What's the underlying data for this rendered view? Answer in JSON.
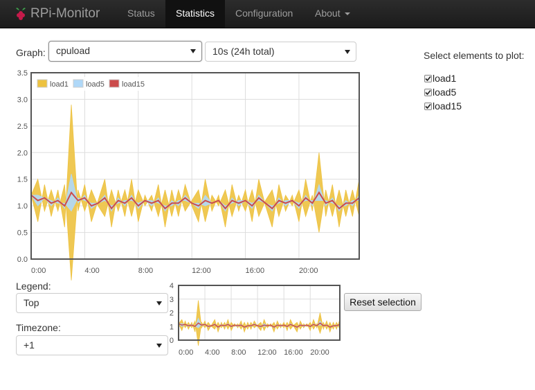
{
  "navbar": {
    "brand": "RPi-Monitor",
    "items": [
      {
        "label": "Status",
        "active": false
      },
      {
        "label": "Statistics",
        "active": true
      },
      {
        "label": "Configuration",
        "active": false
      },
      {
        "label": "About",
        "active": false
      }
    ]
  },
  "graph_select": {
    "label": "Graph:",
    "value": "cpuload"
  },
  "period_select": {
    "value": "10s (24h total)"
  },
  "legend_select": {
    "label": "Legend:",
    "value": "Top"
  },
  "timezone_select": {
    "label": "Timezone:",
    "value": "+1"
  },
  "reset_button": {
    "label": "Reset selection"
  },
  "plot_elements": {
    "title": "Select elements to plot:",
    "items": [
      {
        "label": "load1",
        "checked": true
      },
      {
        "label": "load5",
        "checked": true
      },
      {
        "label": "load15",
        "checked": true
      }
    ]
  },
  "chart_data": [
    {
      "type": "area",
      "x_unit": "hours",
      "xlim": [
        0,
        24.5
      ],
      "ylim": [
        0,
        3.5
      ],
      "y_ticks": [
        0.0,
        0.5,
        1.0,
        1.5,
        2.0,
        2.5,
        3.0,
        3.5
      ],
      "y_tick_labels": [
        "0.0",
        "0.5",
        "1.0",
        "1.5",
        "2.0",
        "2.5",
        "3.0",
        "3.5"
      ],
      "x_ticks": [
        0,
        4,
        8,
        12,
        16,
        20
      ],
      "x_tick_labels": [
        "0:00",
        "4:00",
        "8:00",
        "12:00",
        "16:00",
        "20:00"
      ],
      "grid": true,
      "legend_position": "top-left",
      "x": [
        0,
        0.5,
        1,
        1.5,
        2,
        2.5,
        3,
        3.5,
        4,
        4.5,
        5,
        5.5,
        6,
        6.5,
        7,
        7.5,
        8,
        8.5,
        9,
        9.5,
        10,
        10.5,
        11,
        11.5,
        12,
        12.5,
        13,
        13.5,
        14,
        14.5,
        15,
        15.5,
        16,
        16.5,
        17,
        17.5,
        18,
        18.5,
        19,
        19.5,
        20,
        20.5,
        21,
        21.5,
        22,
        22.5,
        23,
        23.5,
        24,
        24.5
      ],
      "series": [
        {
          "name": "load1",
          "color": "#edc240",
          "values": [
            1.2,
            0.7,
            1.4,
            0.8,
            1.3,
            0.6,
            2.9,
            0.9,
            1.4,
            0.7,
            1.1,
            1.5,
            0.6,
            1.3,
            0.8,
            1.5,
            0.7,
            1.2,
            0.9,
            1.4,
            0.6,
            1.3,
            0.8,
            1.4,
            1.0,
            0.7,
            1.5,
            0.9,
            1.2,
            0.6,
            1.4,
            0.9,
            1.3,
            0.7,
            1.5,
            1.0,
            0.6,
            1.4,
            0.9,
            1.2,
            0.7,
            1.5,
            0.9,
            2.0,
            0.8,
            1.4,
            0.6,
            1.3,
            0.8,
            1.5
          ]
        },
        {
          "name": "load5",
          "color": "#afd8f8",
          "values": [
            1.2,
            1.0,
            1.15,
            1.0,
            1.15,
            0.95,
            1.6,
            1.05,
            1.2,
            0.95,
            1.05,
            1.2,
            0.9,
            1.15,
            1.0,
            1.2,
            0.95,
            1.1,
            1.0,
            1.15,
            0.9,
            1.1,
            1.0,
            1.2,
            1.05,
            0.95,
            1.2,
            1.05,
            1.1,
            0.9,
            1.15,
            1.0,
            1.1,
            0.95,
            1.2,
            1.05,
            0.9,
            1.15,
            1.0,
            1.1,
            0.95,
            1.2,
            1.0,
            1.4,
            1.0,
            1.15,
            0.9,
            1.1,
            1.0,
            1.2
          ]
        },
        {
          "name": "load15",
          "color": "#cb4b4b",
          "values": [
            1.2,
            1.1,
            1.15,
            1.05,
            1.1,
            1.0,
            1.25,
            1.1,
            1.15,
            1.0,
            1.05,
            1.15,
            0.95,
            1.1,
            1.05,
            1.15,
            1.0,
            1.1,
            1.05,
            1.1,
            0.95,
            1.05,
            1.05,
            1.15,
            1.05,
            1.0,
            1.1,
            1.05,
            1.1,
            0.95,
            1.1,
            1.05,
            1.1,
            1.0,
            1.15,
            1.05,
            0.95,
            1.1,
            1.05,
            1.1,
            1.0,
            1.15,
            1.05,
            1.25,
            1.05,
            1.1,
            0.95,
            1.05,
            1.05,
            1.15
          ]
        }
      ]
    },
    {
      "type": "area",
      "x_unit": "hours",
      "xlim": [
        0,
        24.5
      ],
      "ylim": [
        0,
        4
      ],
      "y_ticks": [
        0,
        1,
        2,
        3,
        4
      ],
      "y_tick_labels": [
        "0",
        "1",
        "2",
        "3",
        "4"
      ],
      "x_ticks": [
        0,
        4,
        8,
        12,
        16,
        20
      ],
      "x_tick_labels": [
        "0:00",
        "4:00",
        "8:00",
        "12:00",
        "16:00",
        "20:00"
      ],
      "grid": true,
      "same_series_as": "main"
    }
  ]
}
